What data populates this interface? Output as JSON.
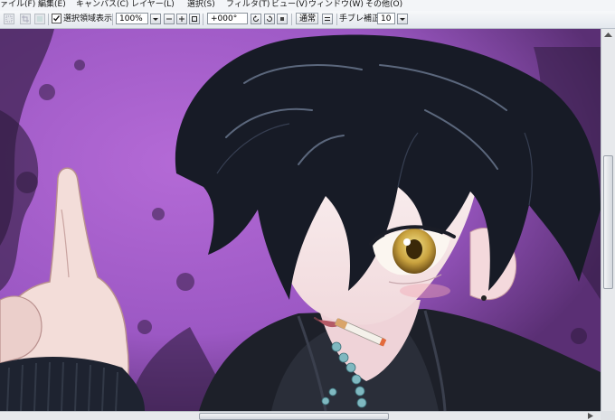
{
  "menubar": {
    "items": [
      {
        "label": "ァイル(F)"
      },
      {
        "label": "編集(E)"
      },
      {
        "label": "キャンバス(C)"
      },
      {
        "label": "レイヤー(L)"
      },
      {
        "label": "選択(S)"
      },
      {
        "label": "フィルタ(T)"
      },
      {
        "label": "ビュー(V)"
      },
      {
        "label": "ウィンドウ(W)"
      },
      {
        "label": "その他(O)"
      }
    ]
  },
  "toolbar": {
    "selection_checkbox": {
      "label": "選択領域表示",
      "checked": true
    },
    "zoom": {
      "value": "100%"
    },
    "rotation": {
      "value": "+000°"
    },
    "blend_mode": {
      "label": "通常"
    },
    "stabilizer": {
      "label": "手ブレ補正",
      "value": "10"
    }
  },
  "canvas": {
    "background_color": "#a95fcd",
    "artwork": "anime-style illustration of a dark-haired character with a cigarette pointing upward"
  },
  "scrollbars": {
    "vertical_position": 0.33,
    "horizontal_position": 0.5
  }
}
